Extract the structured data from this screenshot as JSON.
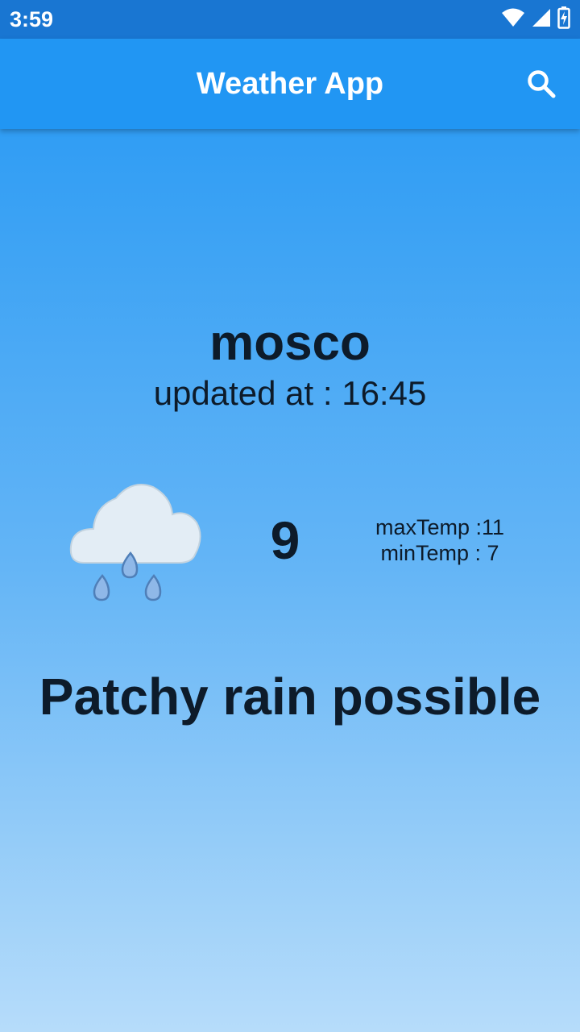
{
  "status_bar": {
    "time": "3:59",
    "icons": [
      "wifi-icon",
      "signal-icon",
      "battery-icon"
    ]
  },
  "app_bar": {
    "title": "Weather App",
    "search_icon": "search-icon"
  },
  "weather": {
    "city": "mosco",
    "updated": "updated at : 16:45",
    "icon": "cloud-rain-icon",
    "temperature": "9",
    "max_temp": "maxTemp :11",
    "min_temp": "minTemp : 7",
    "condition": "Patchy rain possible"
  },
  "colors": {
    "status_bar": "#1976D2",
    "app_bar": "#2196F3",
    "gradient_top": "#2196F3",
    "gradient_bottom": "#B6DCFA",
    "text_dark": "#0d1b2a"
  }
}
